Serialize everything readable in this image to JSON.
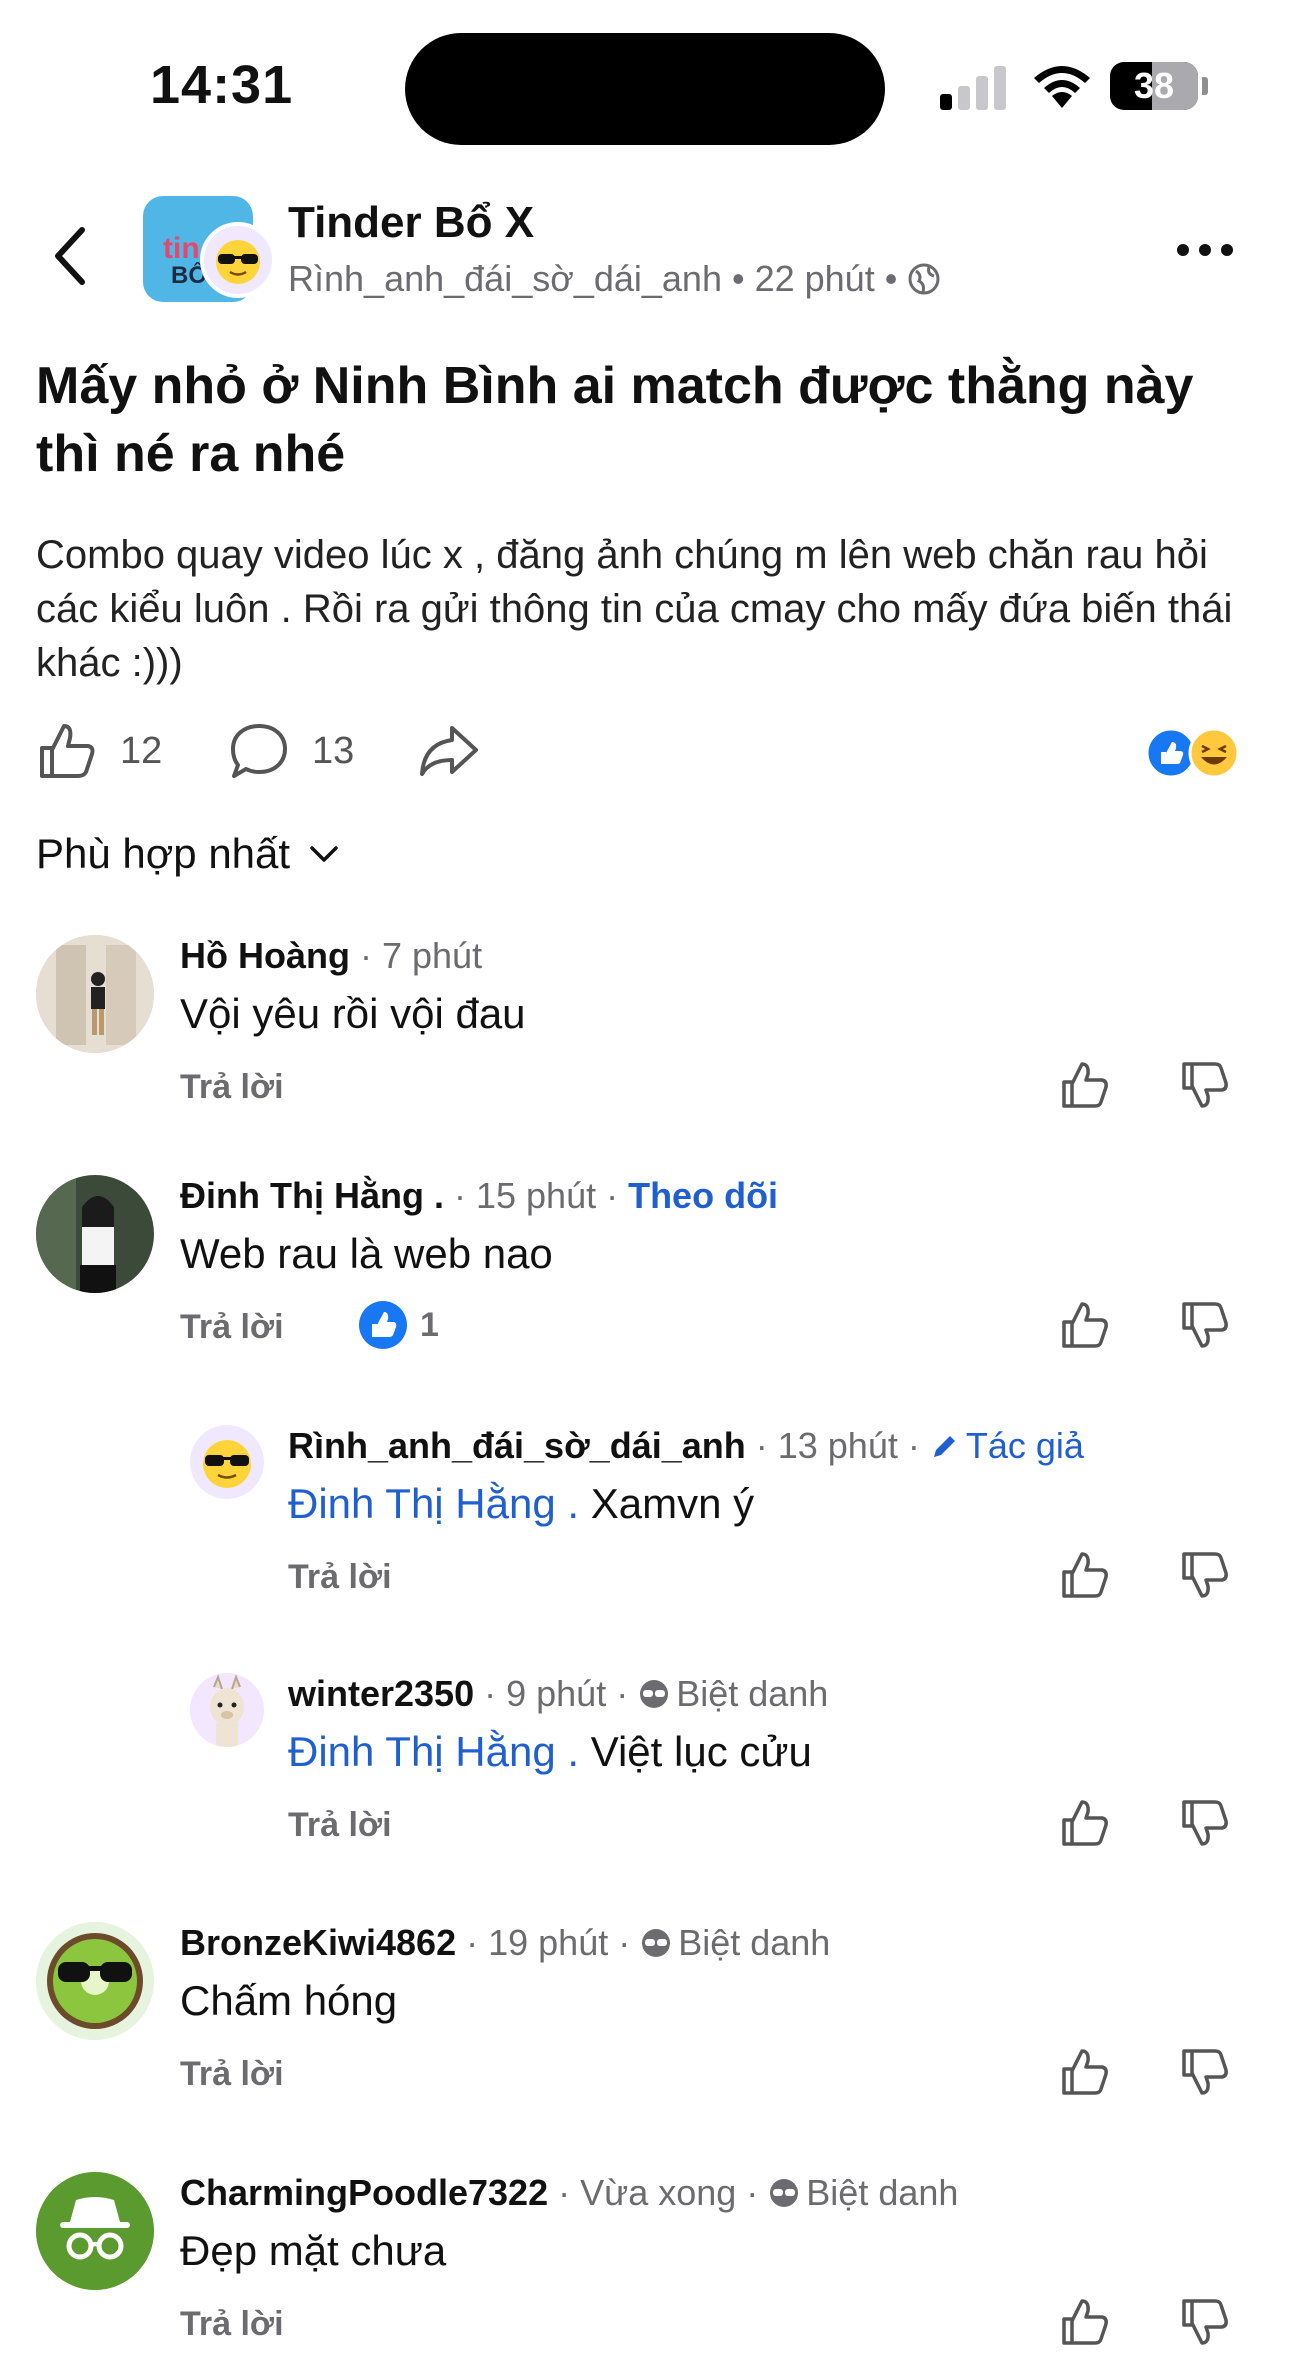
{
  "status_bar": {
    "time": "14:31",
    "battery": "38"
  },
  "header": {
    "group_name": "Tinder Bổ X",
    "author": "Rình_anh_đái_sờ_dái_anh",
    "time": "22 phút",
    "sep": "•",
    "group_logo_line1": "tin",
    "group_logo_line2": "BỔ"
  },
  "post": {
    "title": "Mấy nhỏ ở Ninh Bình ai match được thằng này thì né ra nhé",
    "body": "Combo quay video lúc x , đăng ảnh chúng m lên web chăn rau hỏi các kiểu luôn . Rồi ra gửi thông tin của cmay cho mấy đứa biến thái khác :)))",
    "likes": "12",
    "comments": "13"
  },
  "sort": {
    "label": "Phù hợp nhất"
  },
  "comments": [
    {
      "name": "Hồ Hoàng",
      "time": "· 7 phút",
      "text": "Vội yêu rồi vội đau",
      "reply": "Trả lời"
    },
    {
      "name": "Đinh Thị Hằng .",
      "time": "· 15 phút ·",
      "follow": "Theo dõi",
      "text": "Web rau là web nao",
      "reply": "Trả lời",
      "likes": "1"
    },
    {
      "name": "Rình_anh_đái_sờ_dái_anh",
      "time": "· 13 phút ·",
      "tag": "Tác giả",
      "mention": "Đinh Thị Hằng .",
      "text": "Xamvn ý",
      "reply": "Trả lời"
    },
    {
      "name": "winter2350",
      "time": "· 9 phút ·",
      "tag": "Biệt danh",
      "mention": "Đinh Thị Hằng .",
      "text": "Việt lục cửu",
      "reply": "Trả lời"
    },
    {
      "name": "BronzeKiwi4862",
      "time": "· 19 phút ·",
      "tag": "Biệt danh",
      "text": "Chấm hóng",
      "reply": "Trả lời"
    },
    {
      "name": "CharmingPoodle7322",
      "time": "· Vừa xong ·",
      "tag": "Biệt danh",
      "text": "Đẹp mặt chưa",
      "reply": "Trả lời"
    }
  ],
  "colors": {
    "link": "#1f5fcf",
    "muted": "#6b6b70",
    "like_blue": "#1877f2"
  }
}
